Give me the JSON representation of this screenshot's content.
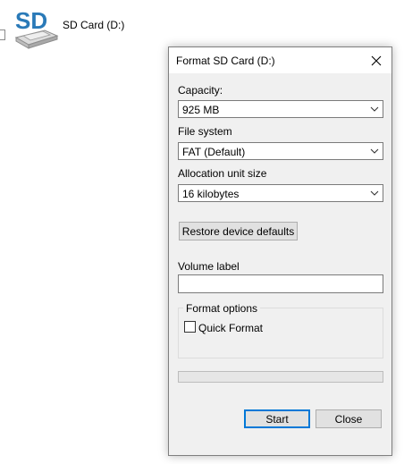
{
  "desktop": {
    "drive_icon_text": "SD",
    "drive_label": "SD Card (D:)"
  },
  "dialog": {
    "title": "Format SD Card (D:)",
    "capacity": {
      "label": "Capacity:",
      "value": "925 MB"
    },
    "file_system": {
      "label": "File system",
      "value": "FAT (Default)"
    },
    "allocation_unit": {
      "label": "Allocation unit size",
      "value": "16 kilobytes"
    },
    "restore_defaults_label": "Restore device defaults",
    "volume_label": {
      "label": "Volume label",
      "value": ""
    },
    "format_options": {
      "legend": "Format options",
      "quick_format_label": "Quick Format",
      "quick_format_checked": false
    },
    "progress": {
      "fraction": 0
    },
    "start_label": "Start",
    "close_label": "Close"
  },
  "colors": {
    "dialog_bg": "#f0f0f0",
    "accent": "#0078d7",
    "sd_icon_blue": "#2a7ab8"
  }
}
